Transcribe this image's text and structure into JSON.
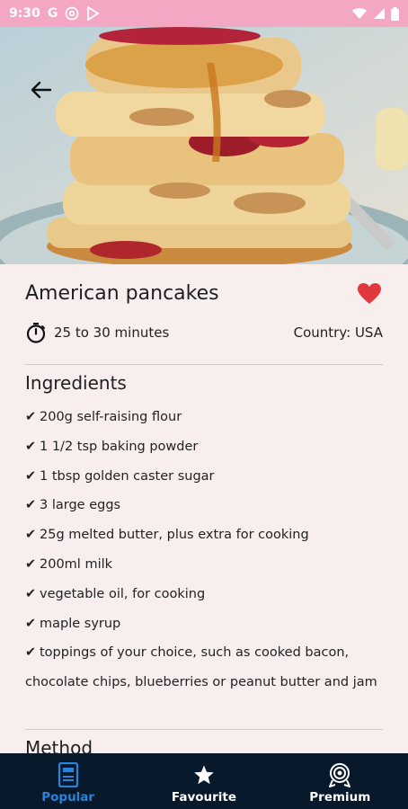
{
  "status_bar": {
    "time": "9:30",
    "app_badge": "G"
  },
  "recipe": {
    "title": "American pancakes",
    "time": "25 to 30 minutes",
    "country": "Country: USA",
    "favorite": true
  },
  "ingredients": {
    "title": "Ingredients",
    "items": [
      "200g self-raising flour",
      "1 1/2 tsp baking powder",
      "1 tbsp golden caster sugar",
      "3 large eggs",
      "25g melted butter, plus extra for cooking",
      "200ml milk",
      "vegetable oil, for cooking",
      "maple syrup",
      "toppings of your choice, such as cooked bacon, chocolate chips, blueberries or peanut butter and jam"
    ],
    "check_mark": "✔"
  },
  "method": {
    "title": "Method"
  },
  "bottom_nav": {
    "items": [
      {
        "label": "Popular",
        "icon": "book-icon",
        "active": true
      },
      {
        "label": "Favourite",
        "icon": "star-icon",
        "active": false
      },
      {
        "label": "Premium",
        "icon": "badge-icon",
        "active": false
      }
    ]
  },
  "colors": {
    "status_bar": "#f3a7c3",
    "background": "#f8eeee",
    "heart": "#e0383c",
    "nav_background": "#07192b",
    "nav_active": "#2b82d9"
  }
}
